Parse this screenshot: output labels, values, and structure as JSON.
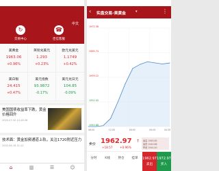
{
  "left": {
    "header": {
      "lang_button": "中文",
      "buttons": [
        {
          "label": "交易中心",
          "icon": "trade-center-icon"
        },
        {
          "label": "佳信客服",
          "icon": "customer-service-icon"
        }
      ]
    },
    "quotes": [
      {
        "name": "美黄金",
        "price": "1963.06",
        "change": "+0.96%",
        "dir": "up"
      },
      {
        "name": "英镑兑美元",
        "price": "1.293",
        "change": "+0.23%",
        "dir": "up"
      },
      {
        "name": "欧元兑美元",
        "price": "1.1749",
        "change": "+0.42%",
        "dir": "up"
      },
      {
        "name": "美白银",
        "price": "24.415",
        "change": "+0.47%",
        "dir": "up"
      },
      {
        "name": "美元指数",
        "price": "93.9872",
        "change": "-0.17%",
        "dir": "down"
      },
      {
        "name": "美元兑日元",
        "price": "104.85",
        "change": "-0.09%",
        "dir": "down"
      }
    ],
    "news": [
      {
        "title": "美国国债收益率下跌，黄金价格回升",
        "meta": "2020-07-30 14:28:38"
      },
      {
        "title": "技术面：黄金加频通道上轨，关注1720附近压力",
        "meta": "2020-06-18 11:12"
      }
    ],
    "tabs": [
      {
        "label": "首页",
        "icon": "home-icon"
      },
      {
        "label": "行情",
        "icon": "chart-icon"
      },
      {
        "label": "资讯",
        "icon": "news-icon"
      },
      {
        "label": "我的",
        "icon": "user-icon"
      }
    ]
  },
  "right": {
    "header": {
      "title": "实盘交易-美黄金",
      "dropdown_icon": "chevron-down-icon",
      "back_icon": "back-arrow-icon",
      "more_icon": "more-icon"
    },
    "y_labels": [
      "1972.36",
      "1965.74",
      "1959.12",
      "1952.50",
      "1945.88"
    ],
    "x_labels": [
      "06:00",
      "12:00",
      "18:00",
      "00:00",
      "04:30"
    ],
    "bid_label": "卖价",
    "price": "1962.97",
    "change": "+18.57",
    "change_pct": "+0.96%",
    "info": [
      "最高 1963.65",
      "最低 1940.88",
      "昨收 1944.40"
    ],
    "bottom_tabs": [
      "分时",
      "K线",
      "持仓",
      "挂单"
    ],
    "sell": {
      "value": "1962.97",
      "label": "卖出"
    },
    "buy": {
      "value": "1972.97",
      "label": "买入"
    }
  },
  "colors": {
    "header_red": "#a8151a",
    "up": "#e0262d",
    "down": "#1d9a4a"
  },
  "chart_data": {
    "type": "line",
    "x": [
      "06:00",
      "08:00",
      "10:00",
      "12:00",
      "14:00",
      "16:00",
      "18:00",
      "20:00",
      "22:00",
      "00:00",
      "02:00",
      "04:30"
    ],
    "series": [
      {
        "values": [
          1944.4,
          1945.3,
          1946.1,
          1948.0,
          1952.5,
          1957.4,
          1961.5,
          1962.6,
          1963.3,
          1963.0,
          1962.7,
          1962.97
        ]
      }
    ],
    "ylim": [
      1945.88,
      1972.36
    ],
    "grid": true
  }
}
